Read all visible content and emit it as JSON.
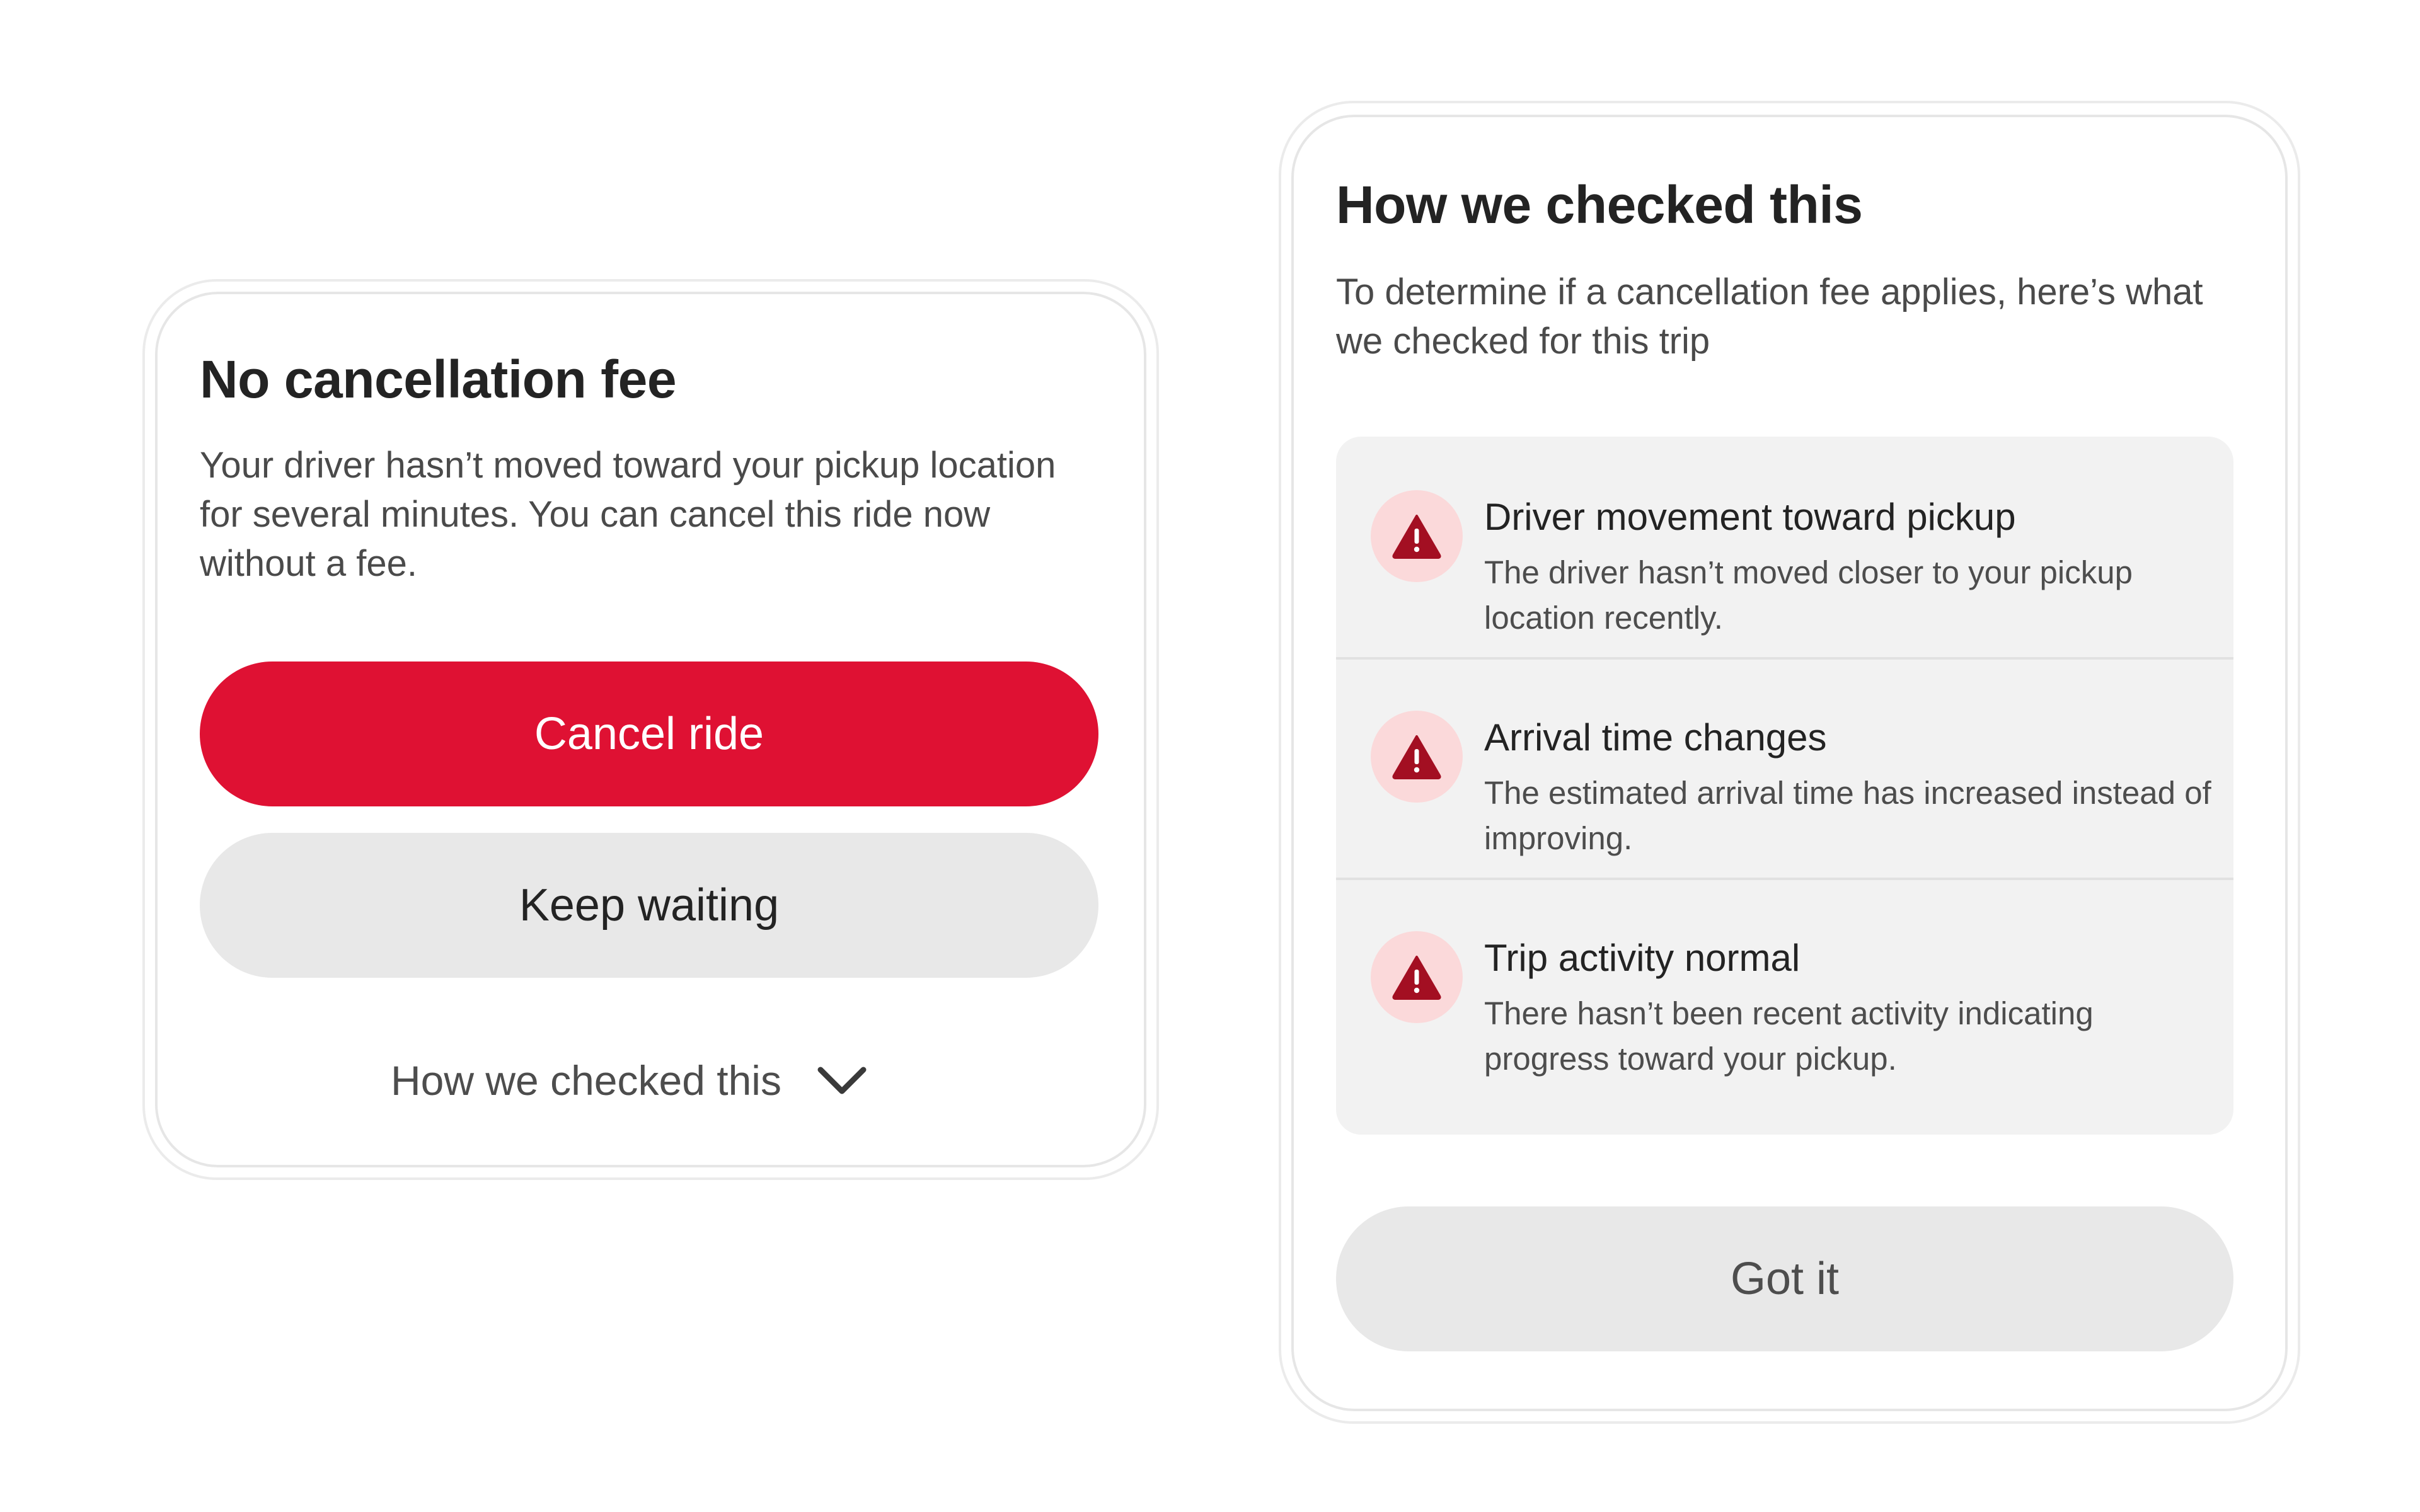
{
  "left_card": {
    "title": "No cancellation fee",
    "body": "Your driver hasn’t moved toward your pickup location for several minutes. You can cancel this ride now without a fee.",
    "primary_button": "Cancel ride",
    "secondary_button": "Keep waiting",
    "disclosure_label": "How we checked this",
    "disclosure_icon": "chevron-down-icon"
  },
  "right_card": {
    "title": "How we checked this",
    "body": "To determine if a cancellation fee applies, here’s what we checked for this trip",
    "checks": [
      {
        "icon": "warning-icon",
        "title": "Driver movement toward pickup",
        "description": "The driver hasn’t moved closer to your pickup location recently."
      },
      {
        "icon": "warning-icon",
        "title": "Arrival time changes",
        "description": "The estimated arrival time has increased instead of improving."
      },
      {
        "icon": "warning-icon",
        "title": "Trip activity normal",
        "description": "There hasn’t been recent activity indicating progress toward your pickup."
      }
    ],
    "button": "Got it"
  },
  "colors": {
    "primary_red": "#df1133",
    "warning_icon": "#a30f22",
    "warning_badge_bg": "#fbd9da",
    "secondary_button_bg": "#e8e8e8",
    "panel_bg": "#f2f2f2"
  }
}
